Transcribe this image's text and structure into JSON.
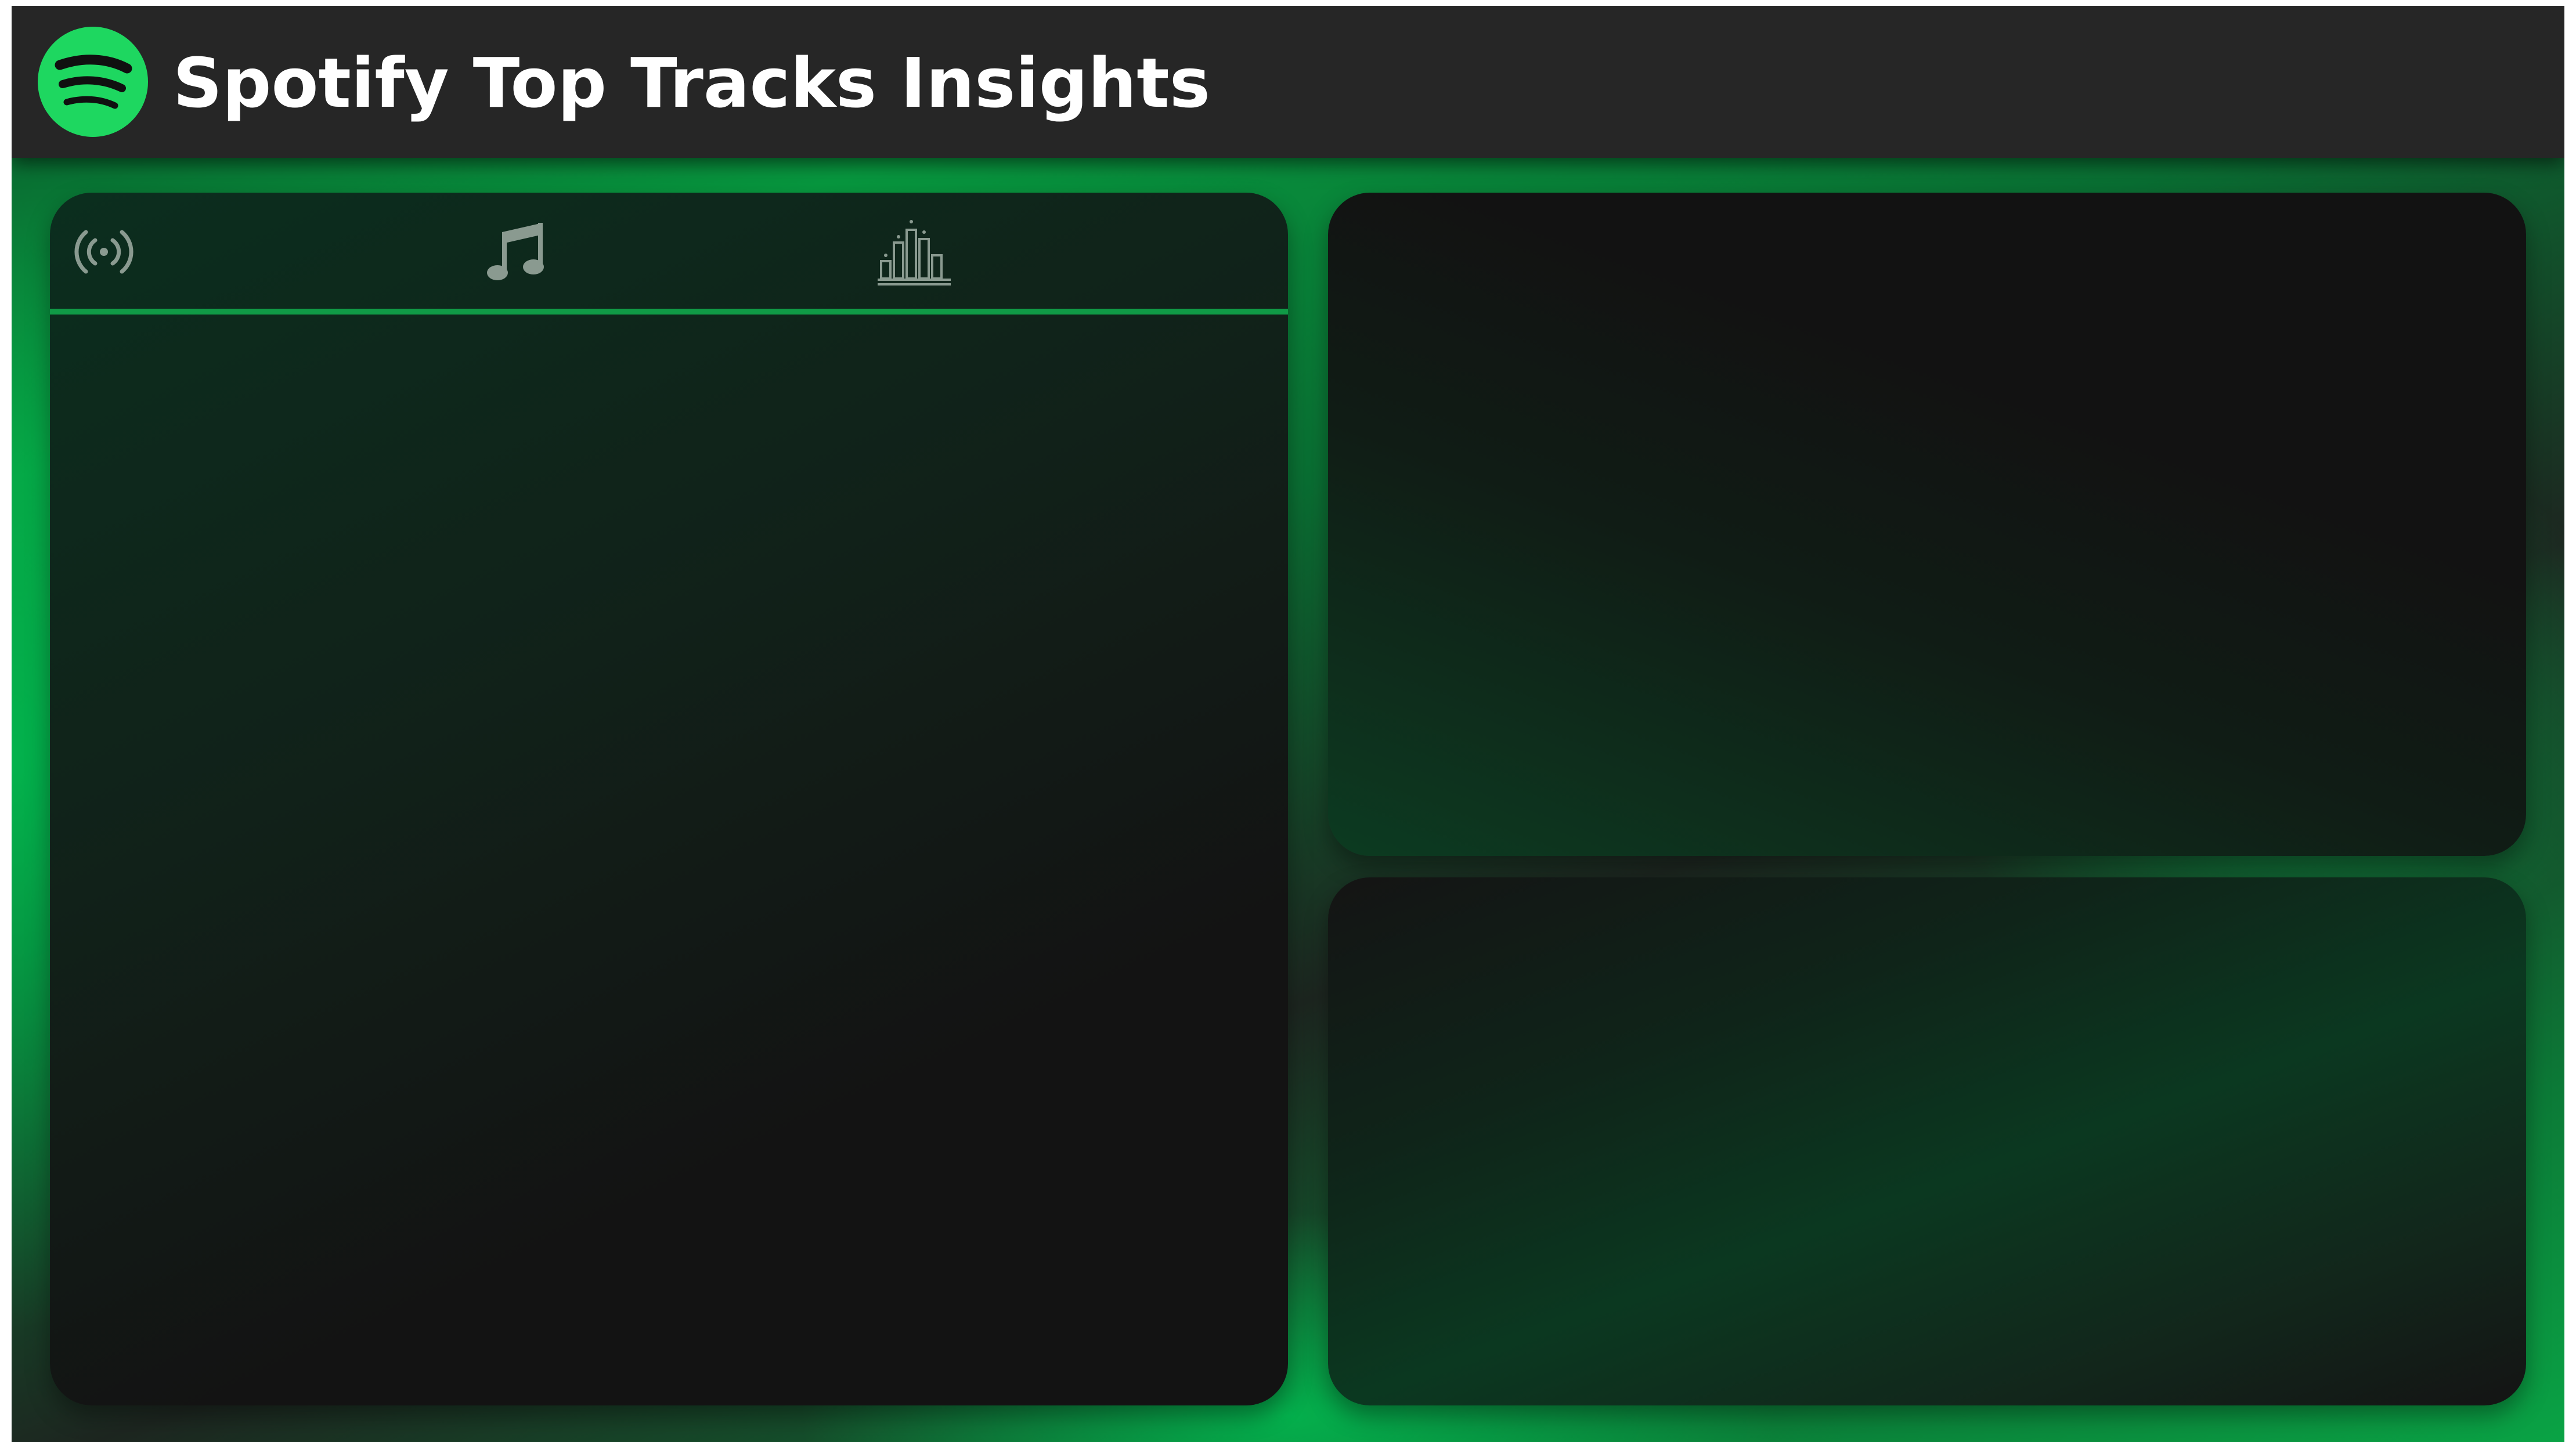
{
  "app": {
    "title": "Spotify Top Tracks Insights",
    "logo_icon": "spotify-logo-icon"
  },
  "colors": {
    "accent": "#1ED760",
    "header_bg": "#262626",
    "panel_bg": "#131313",
    "tab_underline": "#109A46",
    "icon_gray": "#8A9A90"
  },
  "tabs": [
    {
      "icon": "broadcast-icon"
    },
    {
      "icon": "music-note-icon"
    },
    {
      "icon": "bar-chart-icon"
    }
  ]
}
